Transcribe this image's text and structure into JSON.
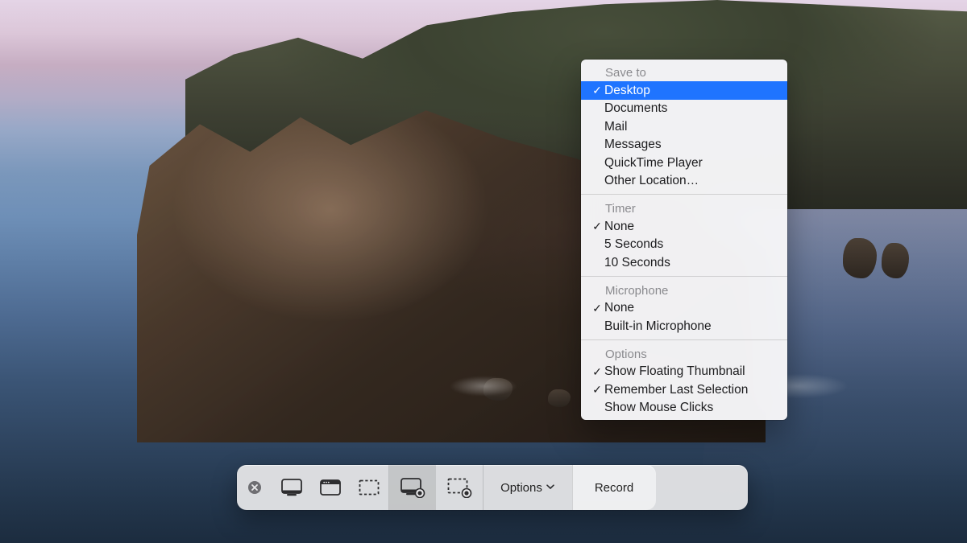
{
  "toolbar": {
    "options_label": "Options",
    "record_label": "Record"
  },
  "menu": {
    "sections": {
      "save_to": {
        "header": "Save to",
        "items": [
          {
            "label": "Desktop",
            "checked": true,
            "highlight": true
          },
          {
            "label": "Documents",
            "checked": false,
            "highlight": false
          },
          {
            "label": "Mail",
            "checked": false,
            "highlight": false
          },
          {
            "label": "Messages",
            "checked": false,
            "highlight": false
          },
          {
            "label": "QuickTime Player",
            "checked": false,
            "highlight": false
          },
          {
            "label": "Other Location…",
            "checked": false,
            "highlight": false
          }
        ]
      },
      "timer": {
        "header": "Timer",
        "items": [
          {
            "label": "None",
            "checked": true,
            "highlight": false
          },
          {
            "label": "5 Seconds",
            "checked": false,
            "highlight": false
          },
          {
            "label": "10 Seconds",
            "checked": false,
            "highlight": false
          }
        ]
      },
      "microphone": {
        "header": "Microphone",
        "items": [
          {
            "label": "None",
            "checked": true,
            "highlight": false
          },
          {
            "label": "Built-in Microphone",
            "checked": false,
            "highlight": false
          }
        ]
      },
      "options": {
        "header": "Options",
        "items": [
          {
            "label": "Show Floating Thumbnail",
            "checked": true,
            "highlight": false
          },
          {
            "label": "Remember Last Selection",
            "checked": true,
            "highlight": false
          },
          {
            "label": "Show Mouse Clicks",
            "checked": false,
            "highlight": false
          }
        ]
      }
    }
  }
}
